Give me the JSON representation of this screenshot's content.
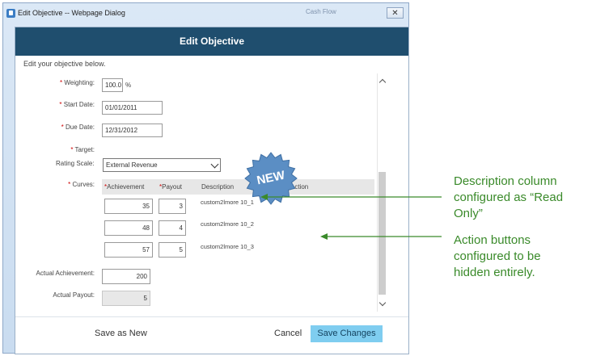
{
  "window": {
    "title": "Edit Objective -- Webpage Dialog",
    "close_glyph": "✕",
    "ghost_text": "Cash Flow"
  },
  "dialog": {
    "header": "Edit Objective",
    "intro": "Edit your objective below.",
    "weighting": {
      "label": "Weighting:",
      "value": "100.0",
      "unit": "%"
    },
    "start_date": {
      "label": "Start Date:",
      "value": "01/01/2011"
    },
    "due_date": {
      "label": "Due Date:",
      "value": "12/31/2012"
    },
    "target": {
      "label": "Target:"
    },
    "rating_scale": {
      "label": "Rating Scale:",
      "value": "External Revenue"
    },
    "curves": {
      "label": "Curves:",
      "columns": {
        "achievement": "Achievement",
        "payout": "Payout",
        "description": "Description",
        "action": "Action"
      },
      "rows": [
        {
          "achievement": "35",
          "payout": "3",
          "description": "custom2lmore 10_1"
        },
        {
          "achievement": "48",
          "payout": "4",
          "description": "custom2lmore 10_2"
        },
        {
          "achievement": "57",
          "payout": "5",
          "description": "custom2lmore 10_3"
        }
      ]
    },
    "actual_achievement": {
      "label": "Actual Achievement:",
      "value": "200"
    },
    "actual_payout": {
      "label": "Actual Payout:",
      "value": "5"
    },
    "required_marker": "*",
    "footer": {
      "save_as_new": "Save as New",
      "cancel": "Cancel",
      "save_changes": "Save Changes"
    }
  },
  "badge": {
    "text": "NEW",
    "color": "#5b8ec4"
  },
  "annotations": {
    "description": [
      "Description column",
      "configured as “Read",
      "Only”"
    ],
    "action": [
      "Action buttons",
      "configured to be",
      "hidden entirely."
    ],
    "color": "#3a8a2a"
  }
}
